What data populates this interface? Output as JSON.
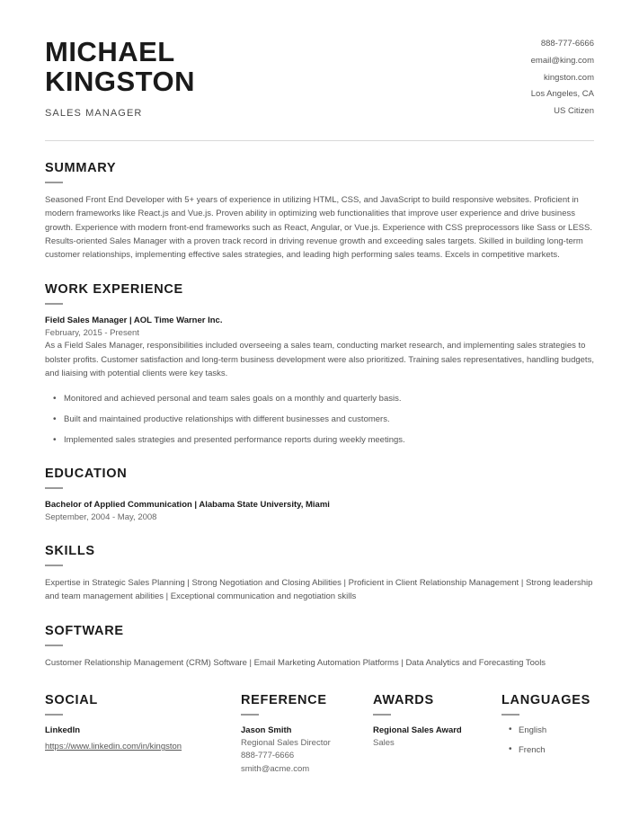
{
  "header": {
    "name_line1": "MICHAEL",
    "name_line2": "KINGSTON",
    "job_title": "SALES MANAGER",
    "contact": {
      "phone": "888-777-6666",
      "email": "email@king.com",
      "website": "kingston.com",
      "location": "Los Angeles, CA",
      "citizenship": "US Citizen"
    }
  },
  "summary": {
    "heading": "SUMMARY",
    "paragraph1": "Seasoned Front End Developer with 5+ years of experience in utilizing HTML, CSS, and JavaScript to build responsive websites. Proficient in modern frameworks like React.js and Vue.js. Proven ability in optimizing web functionalities that improve user experience and drive business growth.  Experience with modern front-end frameworks such as React, Angular, or Vue.js. Experience with CSS preprocessors like Sass or LESS.",
    "paragraph2": "Results-oriented Sales Manager with a proven track record in driving revenue growth and exceeding sales targets. Skilled in building long-term customer relationships, implementing effective sales strategies, and leading high performing sales teams. Excels in competitive markets."
  },
  "work_experience": {
    "heading": "WORK EXPERIENCE",
    "entries": [
      {
        "title": "Field Sales Manager | AOL Time Warner Inc.",
        "date": "February, 2015 - Present",
        "description": "As a Field Sales Manager, responsibilities included overseeing a sales team, conducting market research, and implementing sales strategies to bolster profits. Customer satisfaction and long-term business development were also prioritized. Training sales representatives, handling budgets, and liaising with potential clients were key tasks.",
        "bullets": [
          "Monitored and achieved personal and team sales goals on a monthly and quarterly basis.",
          "Built and maintained productive relationships with different businesses and customers.",
          "Implemented sales strategies and presented performance reports during weekly meetings."
        ]
      }
    ]
  },
  "education": {
    "heading": "EDUCATION",
    "entries": [
      {
        "degree": "Bachelor of Applied Communication | Alabama State University, Miami",
        "date": "September, 2004 - May, 2008"
      }
    ]
  },
  "skills": {
    "heading": "SKILLS",
    "text": "Expertise in Strategic Sales Planning  |  Strong Negotiation and Closing Abilities  |  Proficient in Client Relationship Management  |  Strong leadership and team management abilities  |  Exceptional communication and negotiation skills"
  },
  "software": {
    "heading": "SOFTWARE",
    "text": "Customer Relationship Management (CRM) Software  |  Email Marketing Automation Platforms   |  Data Analytics and Forecasting Tools"
  },
  "social": {
    "heading": "SOCIAL",
    "network": "LinkedIn",
    "url": "https://www.linkedin.com/in/kingston"
  },
  "reference": {
    "heading": "REFERENCE",
    "name": "Jason Smith",
    "role": "Regional Sales Director",
    "phone": "888-777-6666",
    "email": "smith@acme.com"
  },
  "awards": {
    "heading": "AWARDS",
    "title": "Regional Sales Award",
    "category": "Sales"
  },
  "languages": {
    "heading": "LANGUAGES",
    "items": [
      "English",
      "French"
    ]
  }
}
